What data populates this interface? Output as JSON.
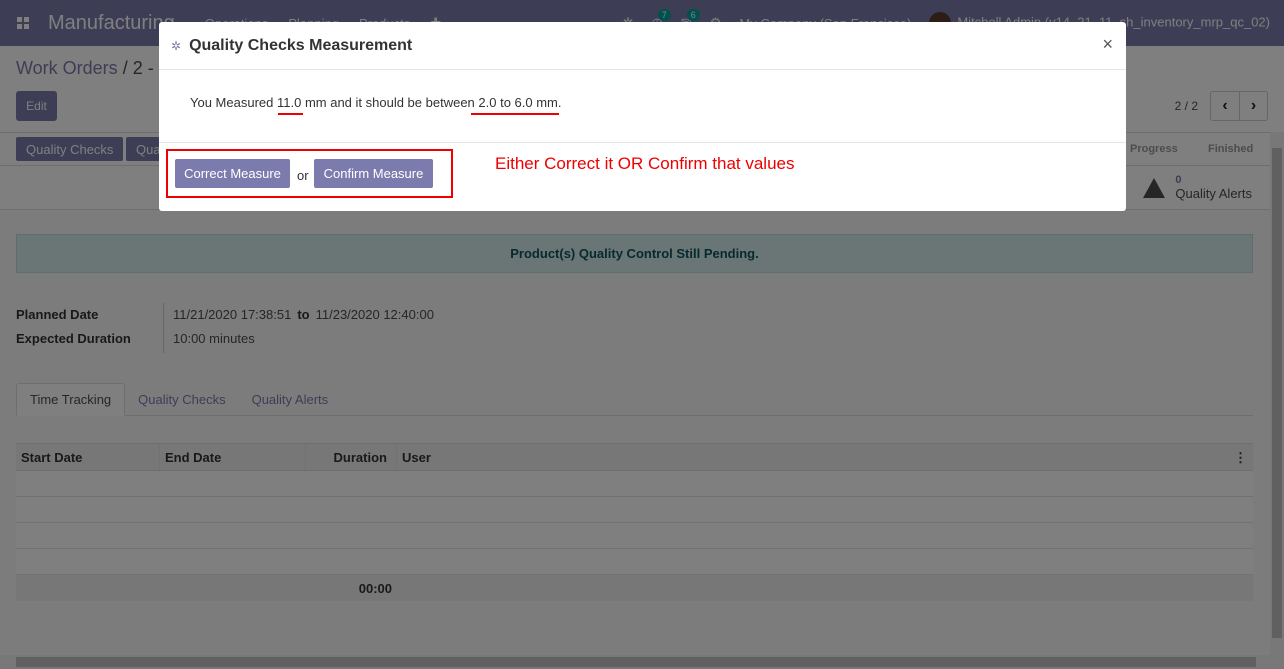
{
  "navbar": {
    "brand": "Manufacturing",
    "menu": [
      "Operations",
      "Planning",
      "Products"
    ],
    "activity_count": "7",
    "message_count": "6",
    "company": "My Company (San Francisco)",
    "user": "Mitchell Admin (v14_21_11_sh_inventory_mrp_qc_02)"
  },
  "breadcrumb": {
    "parent": "Work Orders",
    "sep": "/",
    "current": "2 -"
  },
  "control": {
    "edit_label": "Edit",
    "pager_value": "2 / 2",
    "prev_icon": "‹",
    "next_icon": "›"
  },
  "statusbar": {
    "quality_checks_btn": "Quality Checks",
    "second_btn": "Qua",
    "stages": [
      "Progress",
      "Finished"
    ]
  },
  "smart_alert": {
    "count": "0",
    "label": "Quality Alerts"
  },
  "pending_banner": "Product(s) Quality Control Still Pending.",
  "fields": {
    "planned_date_label": "Planned Date",
    "planned_from": "11/21/2020 17:38:51",
    "planned_to_word": "to",
    "planned_to": "11/23/2020 12:40:00",
    "expected_duration_label": "Expected Duration",
    "expected_duration_value": "10:00",
    "expected_duration_unit": "minutes"
  },
  "tabs": [
    "Time Tracking",
    "Quality Checks",
    "Quality Alerts"
  ],
  "table": {
    "headers": [
      "Start Date",
      "End Date",
      "Duration",
      "User"
    ],
    "total_duration": "00:00"
  },
  "modal": {
    "title": "Quality Checks Measurement",
    "close": "×",
    "msg_prefix": "You Measured",
    "measured_value": "11.0",
    "measured_unit": "mm and it should be between",
    "range_text": "2.0 to 6.0 mm.",
    "correct_btn": "Correct Measure",
    "or_text": "or",
    "confirm_btn": "Confirm Measure",
    "annotation": "Either Correct it OR Confirm that values"
  },
  "colors": {
    "primary": "#7c7bad",
    "annotation_red": "#e00000",
    "banner_bg": "#d4ebea"
  }
}
